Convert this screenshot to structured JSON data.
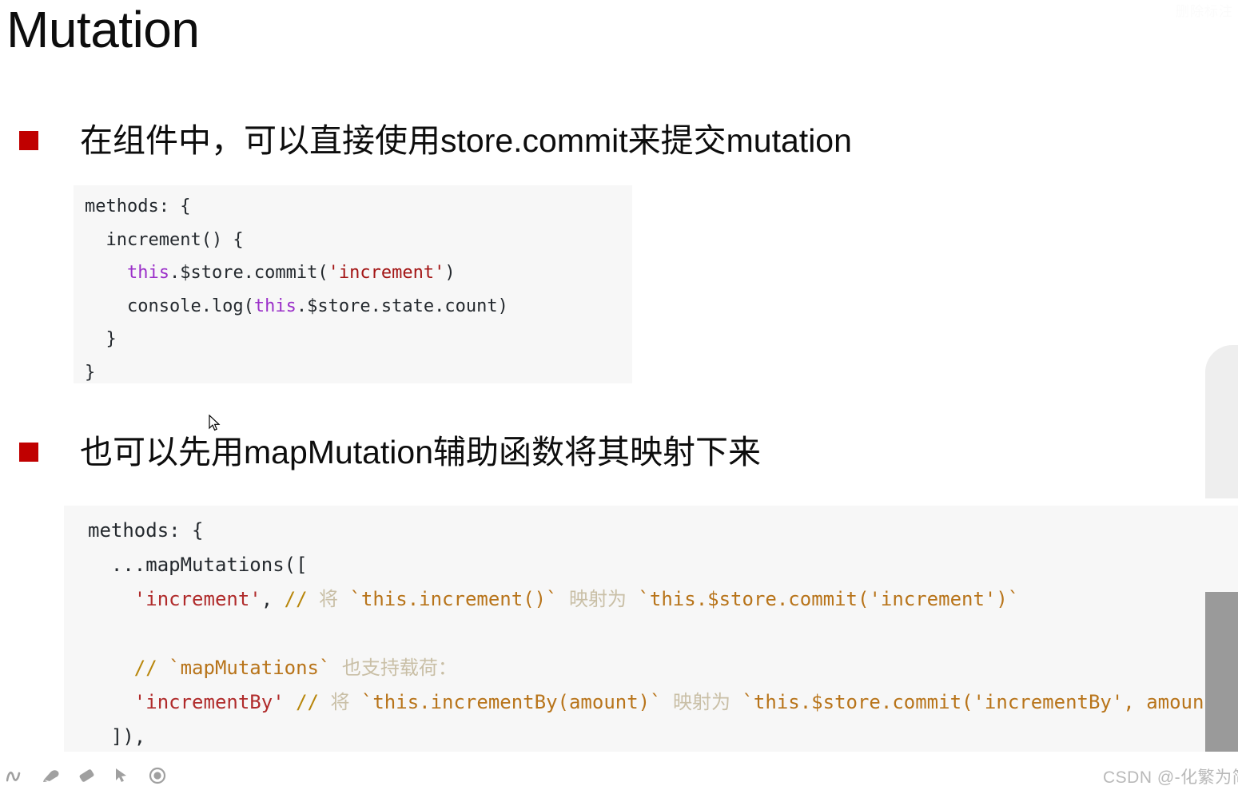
{
  "slide": {
    "title": "Mutation",
    "faint_top_label": "删除标注",
    "bullets": [
      {
        "id": "bullet-one",
        "marker_color": "#c00000",
        "text": "在组件中，可以直接使用store.commit来提交mutation"
      },
      {
        "id": "bullet-two",
        "marker_color": "#c00000",
        "text": "也可以先用mapMutation辅助函数将其映射下来"
      }
    ],
    "code_blocks": [
      {
        "id": "code-block-1",
        "background": "#f7f7f7",
        "lines": [
          [
            {
              "t": "methods: {",
              "c": "tok-plain"
            }
          ],
          [
            {
              "t": "  increment() {",
              "c": "tok-plain"
            }
          ],
          [
            {
              "t": "    ",
              "c": "tok-plain"
            },
            {
              "t": "this",
              "c": "tok-this"
            },
            {
              "t": ".$store.commit(",
              "c": "tok-plain"
            },
            {
              "t": "'increment'",
              "c": "tok-str"
            },
            {
              "t": ")",
              "c": "tok-plain"
            }
          ],
          [
            {
              "t": "    console.log(",
              "c": "tok-plain"
            },
            {
              "t": "this",
              "c": "tok-this"
            },
            {
              "t": ".$store.state.count)",
              "c": "tok-plain"
            }
          ],
          [
            {
              "t": "  }",
              "c": "tok-plain"
            }
          ],
          [
            {
              "t": "}",
              "c": "tok-plain"
            }
          ]
        ],
        "plain_text": "methods: {\n  increment() {\n    this.$store.commit('increment')\n    console.log(this.$store.state.count)\n  }\n}"
      },
      {
        "id": "code-block-2",
        "background": "#f7f7f7",
        "lines": [
          [
            {
              "t": "methods: {",
              "c": "tok-plain"
            }
          ],
          [
            {
              "t": "  ...mapMutations([",
              "c": "tok-plain"
            }
          ],
          [
            {
              "t": "    ",
              "c": "tok-plain"
            },
            {
              "t": "'increment'",
              "c": "tok-str2"
            },
            {
              "t": ",",
              "c": "tok-plain"
            },
            {
              "t": " // ",
              "c": "tok-cmt"
            },
            {
              "t": "将 ",
              "c": "tok-cmt-cn"
            },
            {
              "t": "`this.increment()`",
              "c": "tok-cmt-code"
            },
            {
              "t": " 映射为 ",
              "c": "tok-cmt-cn"
            },
            {
              "t": "`this.$store.commit('increment')`",
              "c": "tok-cmt-code"
            }
          ],
          [
            {
              "t": "",
              "c": "tok-plain"
            }
          ],
          [
            {
              "t": "    // ",
              "c": "tok-cmt"
            },
            {
              "t": "`mapMutations`",
              "c": "tok-cmt-code"
            },
            {
              "t": " 也支持载荷：",
              "c": "tok-cmt-cn"
            }
          ],
          [
            {
              "t": "    ",
              "c": "tok-plain"
            },
            {
              "t": "'incrementBy'",
              "c": "tok-str2"
            },
            {
              "t": " // ",
              "c": "tok-cmt"
            },
            {
              "t": "将 ",
              "c": "tok-cmt-cn"
            },
            {
              "t": "`this.incrementBy(amount)`",
              "c": "tok-cmt-code"
            },
            {
              "t": " 映射为 ",
              "c": "tok-cmt-cn"
            },
            {
              "t": "`this.$store.commit('incrementBy', amount)`",
              "c": "tok-cmt-code"
            }
          ],
          [
            {
              "t": "  ]),",
              "c": "tok-plain"
            }
          ]
        ],
        "plain_text": "methods: {\n  ...mapMutations([\n    'increment', // 将 `this.increment()` 映射为 `this.$store.commit('increment')`\n\n    // `mapMutations` 也支持载荷：\n    'incrementBy' // 将 `this.incrementBy(amount)` 映射为 `this.$store.commit('incrementBy', amount)`\n  ]),"
      }
    ]
  },
  "presenter_toolbar": {
    "tools": [
      {
        "name": "pen-icon",
        "label": "笔"
      },
      {
        "name": "highlighter-icon",
        "label": "荧光笔"
      },
      {
        "name": "eraser-icon",
        "label": "橡皮擦"
      },
      {
        "name": "pointer-arrow-icon",
        "label": "箭头"
      },
      {
        "name": "laser-pointer-icon",
        "label": "激光笔"
      }
    ]
  },
  "watermark": {
    "text": "CSDN @-化繁为简"
  },
  "colors": {
    "bullet_red": "#c00000",
    "code_bg": "#f7f7f7",
    "scrollbar": "#9a9a9a",
    "panel_shape": "#eeeeee",
    "watermark_text": "#b9b9b9"
  }
}
